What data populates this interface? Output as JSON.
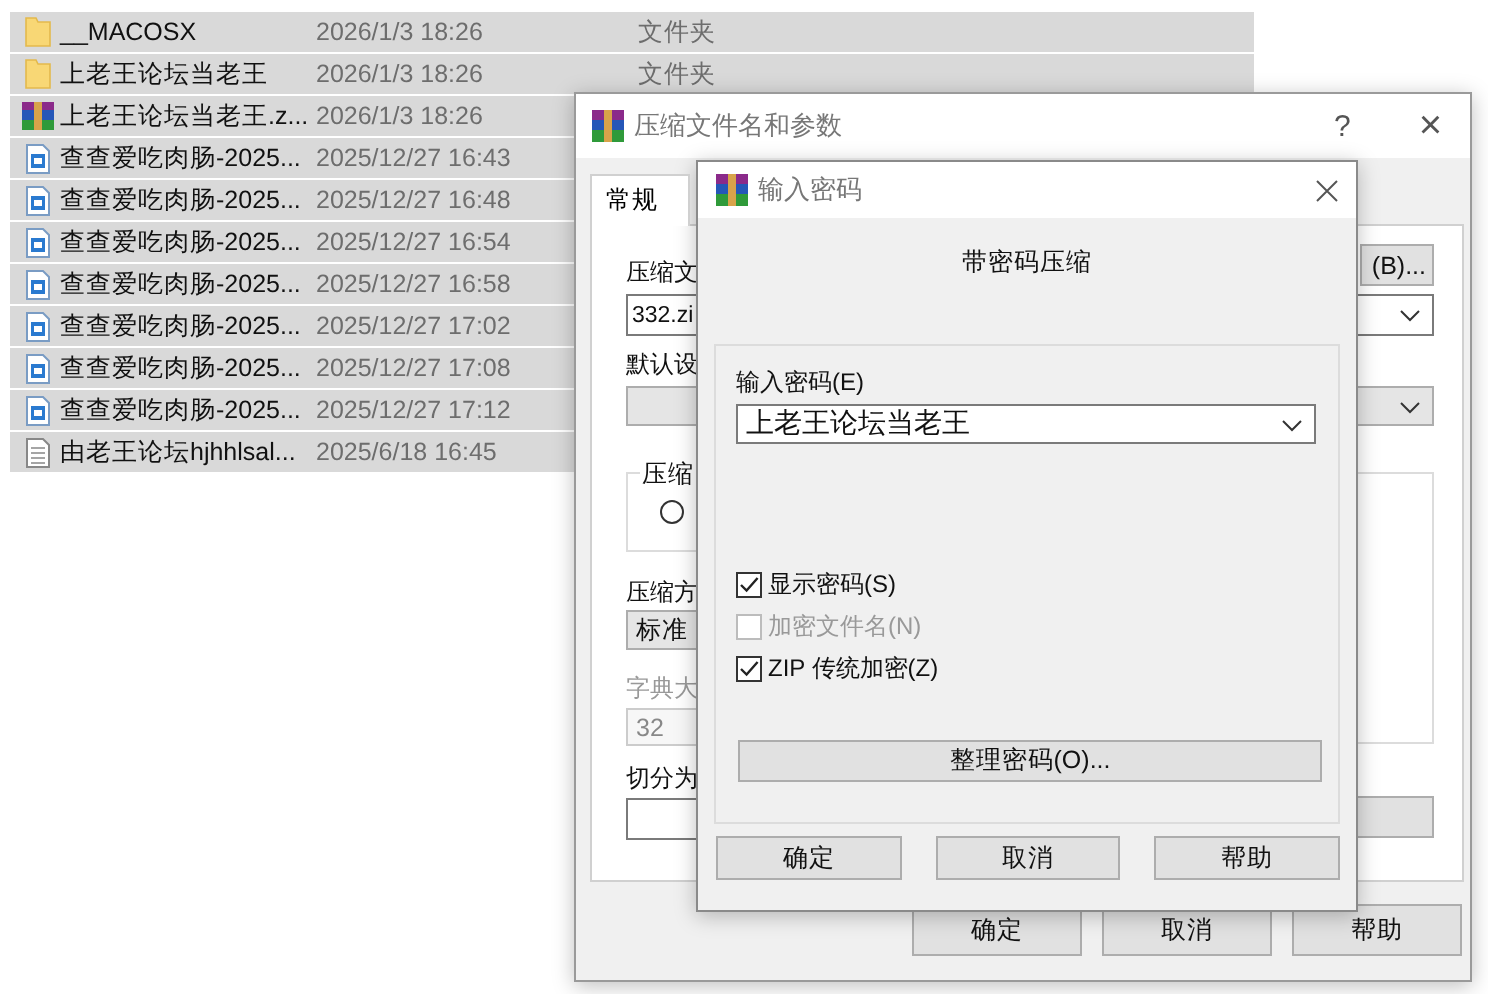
{
  "file_list": [
    {
      "name": "__MACOSX",
      "date": "2026/1/3 18:26",
      "type": "文件夹",
      "kind": "folder",
      "selected": true
    },
    {
      "name": "上老王论坛当老王",
      "date": "2026/1/3 18:26",
      "type": "文件夹",
      "kind": "folder",
      "selected": true
    },
    {
      "name": "上老王论坛当老王.z...",
      "date": "2026/1/3 18:26",
      "kind": "archive",
      "selected": true
    },
    {
      "name": "查查爱吃肉肠-2025...",
      "date": "2025/12/27 16:43",
      "kind": "image",
      "selected": true
    },
    {
      "name": "查查爱吃肉肠-2025...",
      "date": "2025/12/27 16:48",
      "kind": "image",
      "selected": true
    },
    {
      "name": "查查爱吃肉肠-2025...",
      "date": "2025/12/27 16:54",
      "kind": "image",
      "selected": true
    },
    {
      "name": "查查爱吃肉肠-2025...",
      "date": "2025/12/27 16:58",
      "kind": "image",
      "selected": true
    },
    {
      "name": "查查爱吃肉肠-2025...",
      "date": "2025/12/27 17:02",
      "kind": "image",
      "selected": true
    },
    {
      "name": "查查爱吃肉肠-2025...",
      "date": "2025/12/27 17:08",
      "kind": "image",
      "selected": true
    },
    {
      "name": "查查爱吃肉肠-2025...",
      "date": "2025/12/27 17:12",
      "kind": "image",
      "selected": true
    },
    {
      "name": "由老王论坛hjhhlsal...",
      "date": "2025/6/18 16:45",
      "kind": "text",
      "selected": true
    }
  ],
  "archive_dialog": {
    "title": "压缩文件名和参数",
    "help": "?",
    "close": "×",
    "tabs": [
      {
        "label": "常规",
        "selected": true
      }
    ],
    "archive_name_label": "压缩文",
    "archive_name": "332.zi",
    "browse_button": "(B)...",
    "profile_label": "默认设",
    "format_group_label": "压缩",
    "format_radio": {
      "selected": false
    },
    "method_label": "压缩方",
    "method": "标准",
    "dict_label": "字典大",
    "dict_value": "32",
    "split_label": "切分为",
    "buttons": [
      "确定",
      "取消",
      "帮助"
    ]
  },
  "password_dialog": {
    "title": "输入密码",
    "heading": "带密码压缩",
    "password_label": "输入密码(E)",
    "password": "上老王论坛当老王",
    "options": [
      {
        "label": "显示密码(S)",
        "checked": true,
        "disabled": false
      },
      {
        "label": "加密文件名(N)",
        "checked": false,
        "disabled": true
      },
      {
        "label": "ZIP 传统加密(Z)",
        "checked": true,
        "disabled": false
      }
    ],
    "organize_button": "整理密码(O)...",
    "buttons": [
      "确定",
      "取消",
      "帮助"
    ]
  }
}
